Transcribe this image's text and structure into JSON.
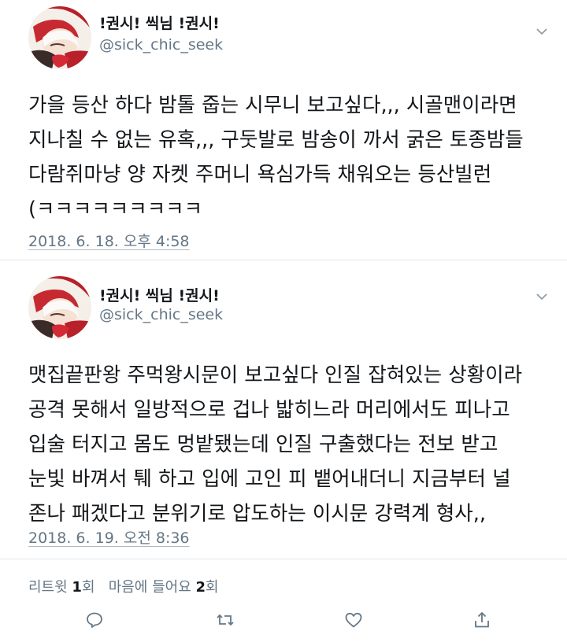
{
  "tweets": [
    {
      "display_name": "!권시! 씩님 !권시!",
      "handle": "@sick_chic_seek",
      "text_lines": [
        "가을 등산 하다 밤톨 줍는 시무니 보고싶다,,, 시골맨이라면",
        "지나칠 수 없는 유혹,,, 구둣발로 밤송이 까서 굵은 토종밤들",
        "다람쥐마냥 양 자켓 주머니 욕심가득 채워오는 등산빌런",
        "(ㅋㅋㅋㅋㅋㅋㅋㅋㅋ"
      ],
      "timestamp": "2018. 6. 18. 오후 4:58"
    },
    {
      "display_name": "!권시! 씩님 !권시!",
      "handle": "@sick_chic_seek",
      "text_lines": [
        "맷집끝판왕 주먹왕시문이 보고싶다 인질 잡혀있는 상황이라",
        "공격 못해서 일방적으로 겁나 밟히느라 머리에서도 피나고",
        "입술 터지고 몸도 멍밭됐는데 인질 구출했다는 전보 받고",
        "눈빛 바껴서 퉤 하고 입에 고인 피 뱉어내더니 지금부터 널",
        "존나 패겠다고 분위기로 압도하는 이시문 강력계 형사,,"
      ],
      "timestamp": "2018. 6. 19. 오전 8:36"
    }
  ],
  "stats": {
    "retweet_label": "리트윗",
    "retweet_count": "1",
    "retweet_unit": "회",
    "like_label": "마음에 들어요",
    "like_count": "2",
    "like_unit": "회"
  },
  "actions": [
    "reply-icon",
    "retweet-icon",
    "like-icon",
    "share-icon"
  ],
  "colors": {
    "text": "#14171a",
    "secondary": "#657786",
    "divider": "#e1e8ed",
    "avatar_red": "#b8202a"
  }
}
